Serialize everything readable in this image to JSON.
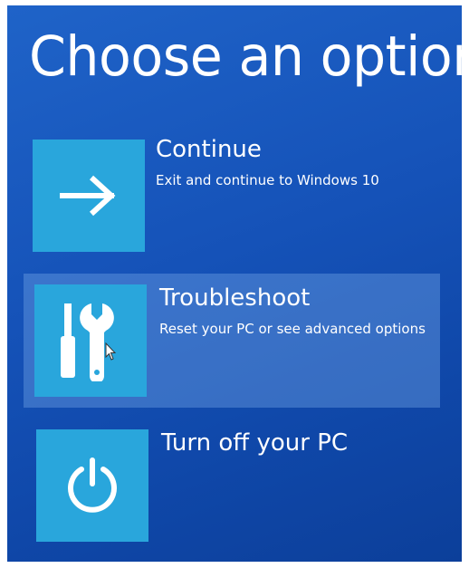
{
  "screen": {
    "title": "Choose an option"
  },
  "options": [
    {
      "label": "Continue",
      "description": "Exit and continue to Windows 10",
      "icon": "arrow-right-icon"
    },
    {
      "label": "Troubleshoot",
      "description": "Reset your PC or see advanced options",
      "icon": "tools-icon"
    },
    {
      "label": "Turn off your PC",
      "description": "",
      "icon": "power-icon"
    }
  ],
  "colors": {
    "background": "#1552b8",
    "tile": "#29a6dc",
    "highlight": "rgba(120,170,235,0.38)",
    "text": "#ffffff"
  },
  "state": {
    "selected_option": "Troubleshoot"
  }
}
